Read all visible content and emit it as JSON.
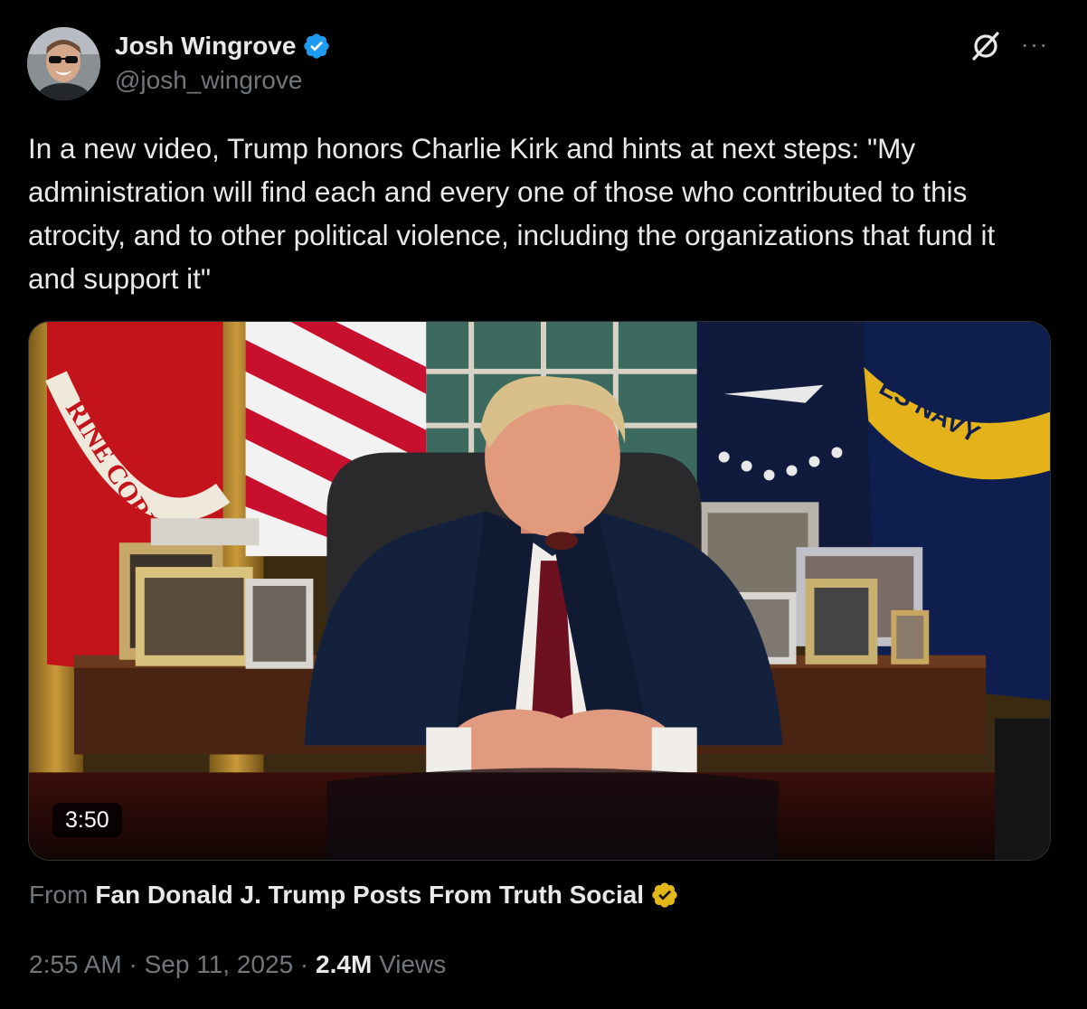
{
  "author": {
    "display_name": "Josh Wingrove",
    "handle": "@josh_wingrove",
    "verified_icon": "verified-badge-icon",
    "avatar_icon": "avatar"
  },
  "tweet": {
    "text": "In a new video, Trump honors Charlie Kirk and hints at next steps: \"My administration will find each and every one of those who contributed to this atrocity, and to other political violence, including the organizations that fund it and support it\""
  },
  "media": {
    "type": "video",
    "duration": "3:50",
    "flag_text_left": "RINE CORP",
    "flag_text_right": "ES NAVY"
  },
  "source": {
    "prefix": "From",
    "name": "Fan Donald J. Trump Posts From Truth Social",
    "badge_icon": "gold-verified-badge-icon"
  },
  "meta": {
    "time": "2:55 AM",
    "separator": "·",
    "date": "Sep 11, 2025",
    "views_count": "2.4M",
    "views_label": "Views"
  },
  "actions": {
    "grok_icon": "grok-icon",
    "more_icon": "more-options-icon",
    "more_label": "···"
  },
  "colors": {
    "background": "#000000",
    "text_primary": "#e7e9ea",
    "text_secondary": "#71767b",
    "verified_blue": "#1d9bf0",
    "verified_gold": "#e2b719"
  }
}
